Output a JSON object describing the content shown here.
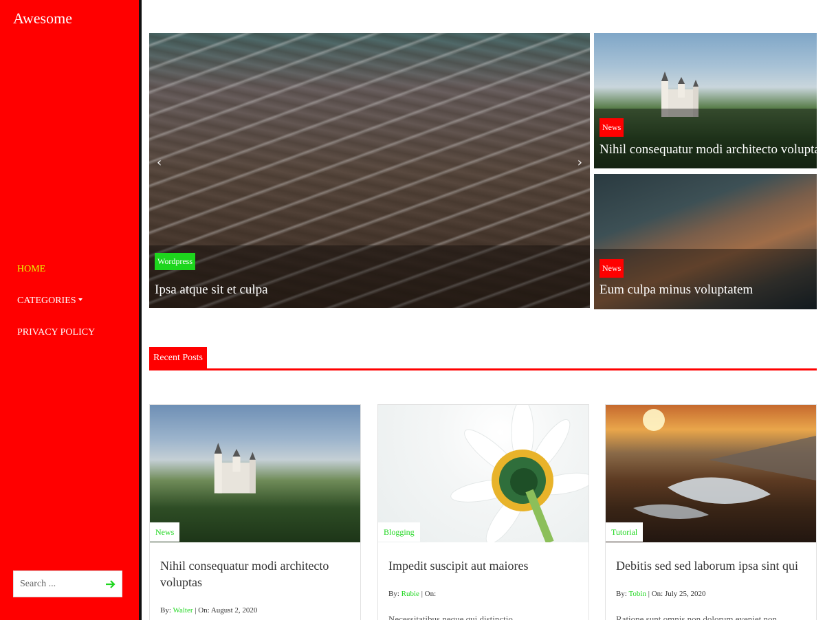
{
  "site": {
    "title": "Awesome"
  },
  "nav": {
    "items": [
      {
        "label": "HOME",
        "active": true
      },
      {
        "label": "CATEGORIES",
        "dropdown": true
      },
      {
        "label": "PRIVACY POLICY"
      }
    ]
  },
  "search": {
    "placeholder": "Search ..."
  },
  "slider": {
    "category": "Wordpress",
    "title": "Ipsa atque sit et culpa",
    "prev": "‹",
    "next": "›"
  },
  "side_posts": [
    {
      "category": "News",
      "title": "Nihil consequatur modi architecto voluptas"
    },
    {
      "category": "News",
      "title": "Eum culpa minus voluptatem"
    }
  ],
  "section": {
    "label": "Recent Posts"
  },
  "cards": [
    {
      "category": "News",
      "title": "Nihil consequatur modi architecto voluptas",
      "by": "By:",
      "author": "Walter",
      "sep": " | ",
      "on": "On:",
      "date": " August 2, 2020",
      "excerpt": ""
    },
    {
      "category": "Blogging",
      "title": "Impedit suscipit aut maiores",
      "by": "By:",
      "author": "Rubie",
      "sep": " | ",
      "on": "On:",
      "date": "",
      "excerpt": "Necessitatibus neque qui distinctio"
    },
    {
      "category": "Tutorial",
      "title": "Debitis sed sed laborum ipsa sint qui",
      "by": "By:",
      "author": "Tobin",
      "sep": " | ",
      "on": "On:",
      "date": " July 25, 2020",
      "excerpt": "Ratione sunt omnis non dolorum eveniet non"
    }
  ],
  "colors": {
    "sidebar": "#ff0000",
    "accent_green": "#1dd61d",
    "active_nav": "#e6ff00"
  }
}
